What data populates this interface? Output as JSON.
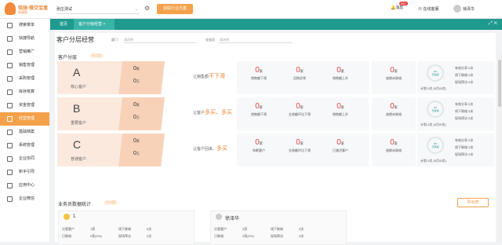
{
  "header": {
    "logo_text": "铭驰·微交宝盒",
    "logo_sub": "私域版",
    "store": "张庄测试",
    "industry_button": "获取行业方案",
    "message_label": "消息",
    "message_badge": "99+",
    "service_label": "在线客服",
    "username": "徐泽华"
  },
  "sidebar": {
    "items": [
      {
        "label": "搜索菜单"
      },
      {
        "label": "快捷导航"
      },
      {
        "label": "营销推广"
      },
      {
        "label": "销售管理"
      },
      {
        "label": "采购管理"
      },
      {
        "label": "库存核算"
      },
      {
        "label": "资金管理"
      },
      {
        "label": "经营管理"
      },
      {
        "label": "基础档案"
      },
      {
        "label": "系统管理"
      },
      {
        "label": "企业协同"
      },
      {
        "label": "新手引导"
      },
      {
        "label": "应用中心"
      },
      {
        "label": "企业微信"
      }
    ]
  },
  "tabs": {
    "home": "首页",
    "active": "客户分级经营"
  },
  "page": {
    "title": "客户分层经营",
    "filter_dept_label": "部门",
    "filter_dept_placeholder": "请选择",
    "filter_sales_label": "业务员",
    "filter_sales_placeholder": "请选择"
  },
  "segments": {
    "heading": "客户分层",
    "tag": "十二月",
    "rows": [
      {
        "letter": "A",
        "desc": "核心客户",
        "count": "0",
        "count_unit": "家",
        "amount": "0",
        "amount_unit": "万",
        "pitch_prefix": "让销售额",
        "pitch_hl": "不下滑",
        "stats": [
          {
            "value": "0",
            "unit": "家",
            "label": "销售额下滑"
          },
          {
            "value": "0",
            "unit": "家",
            "label": "回购异常"
          },
          {
            "value": "0",
            "unit": "家",
            "label": "销售额上升"
          },
          {
            "value": "0",
            "unit": "家",
            "label": "逾期未联络"
          }
        ],
        "ring_pct": "0%",
        "ring_label": "已联络",
        "plan": "计划 0次 (0月/0次)",
        "side": [
          "有效分享 0次",
          "线下联络 0次",
          "现场拜访 0次"
        ]
      },
      {
        "letter": "B",
        "desc": "重要客户",
        "count": "0",
        "count_unit": "家",
        "amount": "0",
        "amount_unit": "万",
        "pitch_prefix": "让客户",
        "pitch_hl": "多买、多买",
        "stats": [
          {
            "value": "0",
            "unit": "家",
            "label": "销售额下滑"
          },
          {
            "value": "0",
            "unit": "家",
            "label": "交易额环比下滑"
          },
          {
            "value": "0",
            "unit": "家",
            "label": "销售额上升"
          },
          {
            "value": "0",
            "unit": "家",
            "label": "逾期未联络"
          }
        ],
        "ring_pct": "0%",
        "ring_label": "已联络",
        "plan": "计划 0次 (0月/0次)",
        "side": [
          "有效分享 0次",
          "线下联络 0次",
          "现场拜访 0次"
        ]
      },
      {
        "letter": "C",
        "desc": "普通客户",
        "count": "0",
        "count_unit": "家",
        "amount": "0",
        "amount_unit": "万",
        "pitch_prefix": "让客户回来、",
        "pitch_hl": "多买",
        "stats": [
          {
            "value": "0",
            "unit": "家",
            "label": "休眠客户"
          },
          {
            "value": "0",
            "unit": "家",
            "label": "交易额环比下滑"
          },
          {
            "value": "0",
            "unit": "家",
            "label": "已激活客户"
          },
          {
            "value": "0",
            "unit": "家",
            "label": "逾期未联络"
          }
        ],
        "ring_pct": "0%",
        "ring_label": "已联络",
        "plan": "计划 0次 (0月/0次)",
        "side": [
          "有效分享 0次",
          "线下联络 0次",
          "现场拜访 0次"
        ]
      }
    ]
  },
  "salesman": {
    "heading": "业务员数据统计",
    "tag": "十二月",
    "export": "导出表",
    "cards": [
      {
        "name": "1",
        "r1": [
          "分管客户",
          "1家",
          "线下联络",
          "0次"
        ],
        "r2": [
          "已联络",
          "0家(0%)",
          "现场拜访",
          "0次"
        ]
      },
      {
        "name": "徐泽华",
        "r1": [
          "分管客户",
          "0家",
          "线下联络",
          "0次"
        ],
        "r2": [
          "已联络",
          "0家(0%)",
          "现场拜访",
          "0次"
        ]
      }
    ]
  }
}
